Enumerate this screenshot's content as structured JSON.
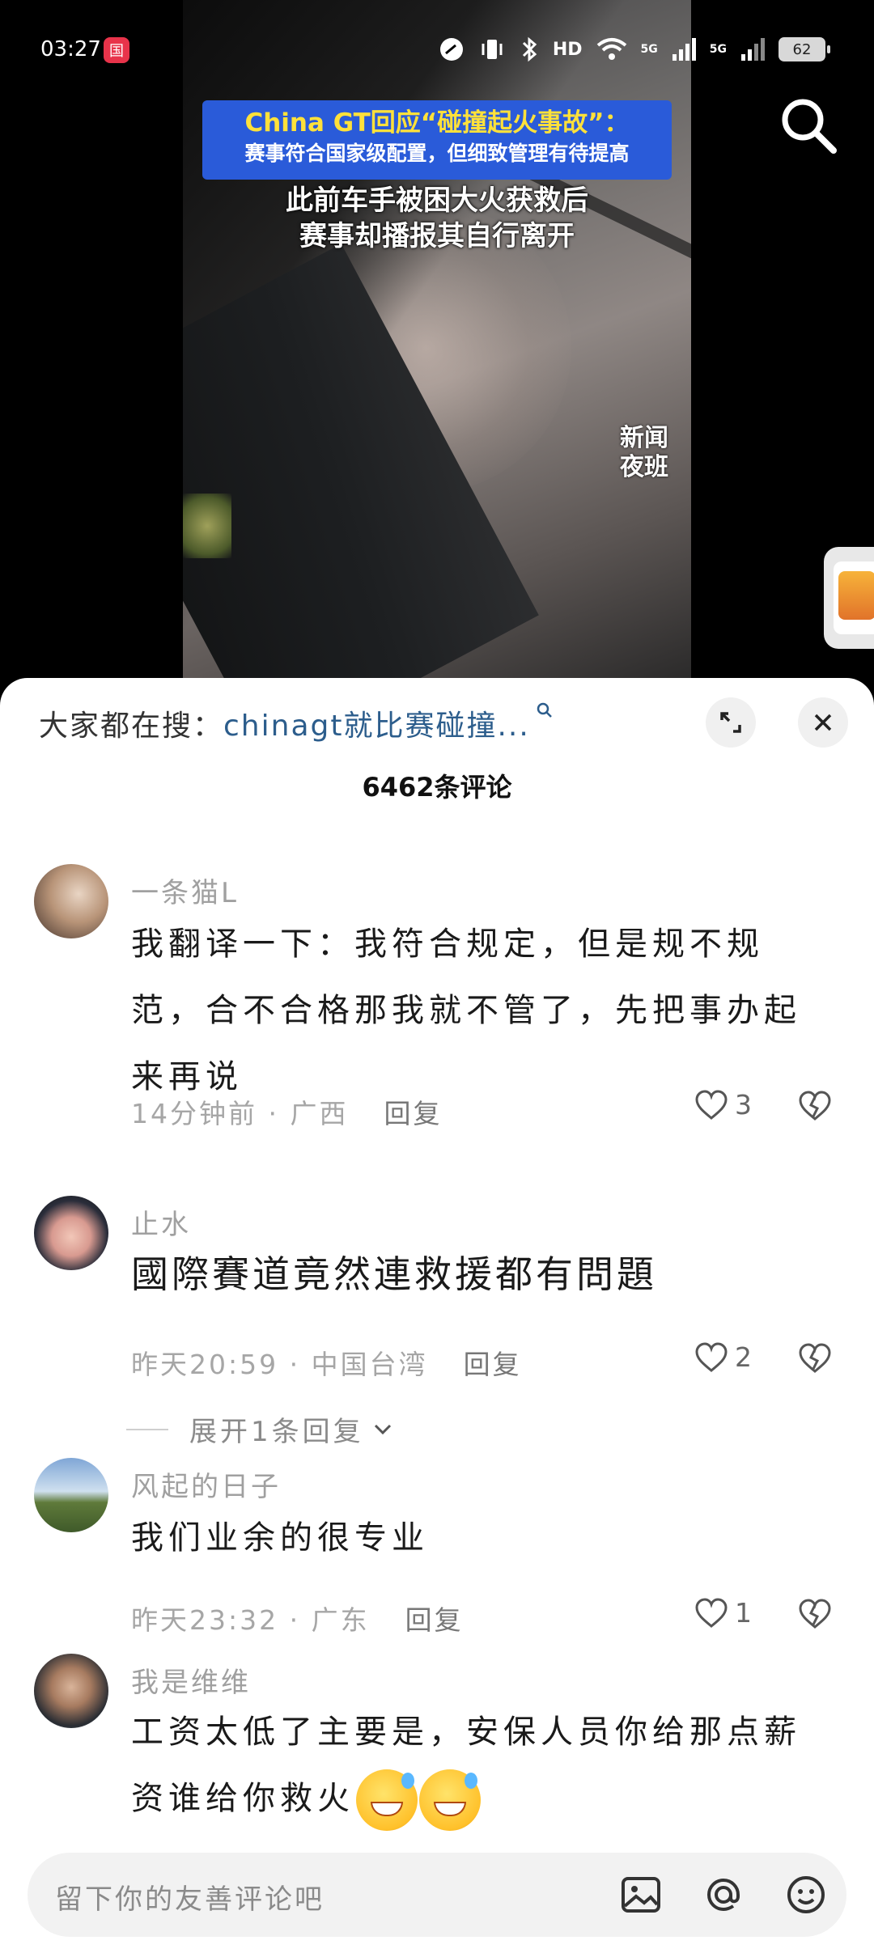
{
  "status_bar": {
    "time": "03:27",
    "app_badge": "国",
    "hd_label": "HD",
    "net1": "5G",
    "net2": "5G",
    "battery": "62"
  },
  "video": {
    "headline_line1": "China GT回应“碰撞起火事故”：",
    "headline_line2": "赛事符合国家级配置，但细致管理有待提高",
    "subtitle_line1": "此前车手被困大火获救后",
    "subtitle_line2": "赛事却播报其自行离开",
    "watermark": "新闻夜班"
  },
  "sheet": {
    "hot_search_label": "大家都在搜：",
    "hot_search_query": "chinagt就比赛碰撞...",
    "comment_count": "6462条评论"
  },
  "comments": [
    {
      "name": "一条猫L",
      "text": "我翻译一下：我符合规定，但是规不规范，合不合格那我就不管了，先把事办起来再说",
      "time": "14分钟前",
      "location": "广西",
      "reply_label": "回复",
      "likes": "3"
    },
    {
      "name": "止水",
      "text": "國際賽道竟然連救援都有問題",
      "time": "昨天20:59",
      "location": "中国台湾",
      "reply_label": "回复",
      "likes": "2",
      "expand_label": "展开1条回复"
    },
    {
      "name": "风起的日子",
      "text": "我们业余的很专业",
      "time": "昨天23:32",
      "location": "广东",
      "reply_label": "回复",
      "likes": "1"
    },
    {
      "name": "我是维维",
      "text": "工资太低了主要是，安保人员你给那点薪资谁给你救火",
      "emoji_count": 2
    }
  ],
  "input": {
    "placeholder": "留下你的友善评论吧"
  },
  "icons": [
    "search-icon",
    "expand-icon",
    "close-icon",
    "heart-icon",
    "broken-heart-icon",
    "image-icon",
    "at-icon",
    "smiley-icon",
    "chevron-down-icon"
  ]
}
